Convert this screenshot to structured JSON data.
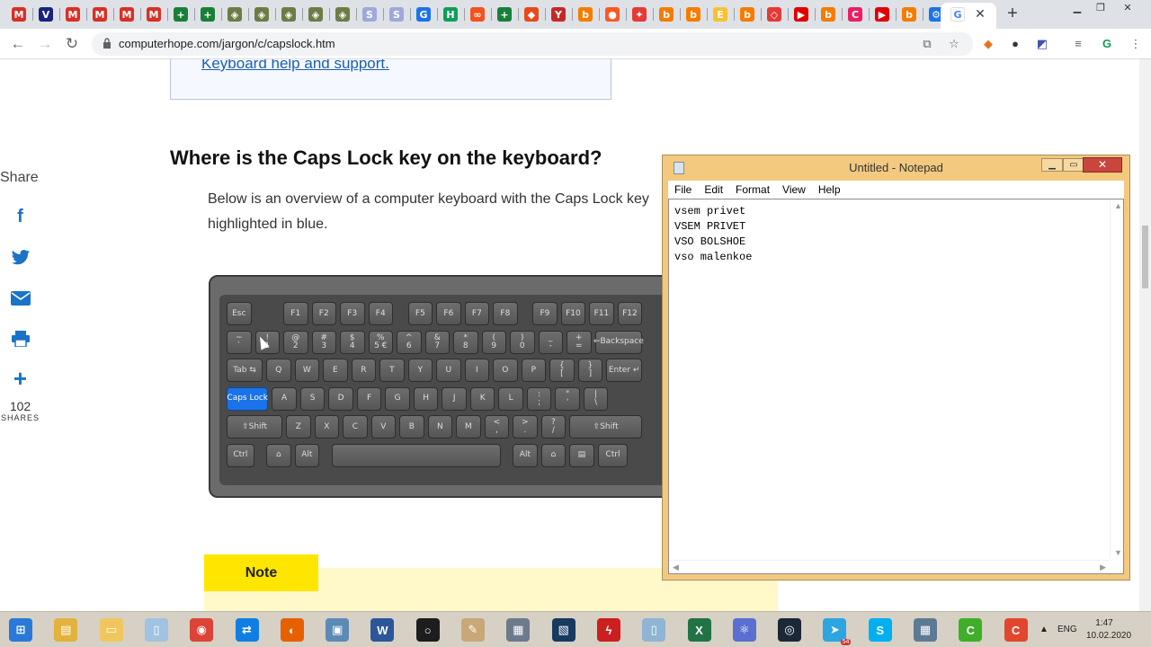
{
  "browser": {
    "url": "computerhope.com/jargon/c/capslock.htm",
    "tabs": [
      {
        "letter": "M",
        "color": "#d93025",
        "icon": "gmail-icon"
      },
      {
        "letter": "V",
        "color": "#1a237e",
        "icon": "v-icon"
      },
      {
        "letter": "M",
        "color": "#d93025",
        "icon": "gmail-icon"
      },
      {
        "letter": "M",
        "color": "#d93025",
        "icon": "gmail-icon"
      },
      {
        "letter": "M",
        "color": "#d93025",
        "icon": "gmail-icon"
      },
      {
        "letter": "M",
        "color": "#d93025",
        "icon": "gmail-icon"
      },
      {
        "letter": "+",
        "color": "#188038",
        "icon": "sheets-icon"
      },
      {
        "letter": "+",
        "color": "#188038",
        "icon": "sheets-icon"
      },
      {
        "letter": "◈",
        "color": "#6b7d44",
        "icon": "site-icon"
      },
      {
        "letter": "◈",
        "color": "#6b7d44",
        "icon": "site-icon"
      },
      {
        "letter": "◈",
        "color": "#6b7d44",
        "icon": "site-icon"
      },
      {
        "letter": "◈",
        "color": "#6b7d44",
        "icon": "site-icon"
      },
      {
        "letter": "◈",
        "color": "#6b7d44",
        "icon": "site-icon"
      },
      {
        "letter": "S",
        "color": "#9fa8da",
        "icon": "sp-icon"
      },
      {
        "letter": "S",
        "color": "#9fa8da",
        "icon": "sp-icon"
      },
      {
        "letter": "G",
        "color": "#1a73e8",
        "icon": "google-icon"
      },
      {
        "letter": "H",
        "color": "#0f9d58",
        "icon": "h-icon"
      },
      {
        "letter": "∞",
        "color": "#f4511e",
        "icon": "link-icon"
      },
      {
        "letter": "+",
        "color": "#188038",
        "icon": "sheets-icon"
      },
      {
        "letter": "◆",
        "color": "#e64a19",
        "icon": "brave-icon"
      },
      {
        "letter": "Y",
        "color": "#c62828",
        "icon": "y-icon"
      },
      {
        "letter": "b",
        "color": "#f57c00",
        "icon": "blogger-icon"
      },
      {
        "letter": "●",
        "color": "#ff5722",
        "icon": "reddit-icon"
      },
      {
        "letter": "✦",
        "color": "#e53935",
        "icon": "star-site-icon"
      },
      {
        "letter": "b",
        "color": "#f57c00",
        "icon": "blogger-icon"
      },
      {
        "letter": "b",
        "color": "#f57c00",
        "icon": "blogger-icon"
      },
      {
        "letter": "E",
        "color": "#fbc02d",
        "icon": "e-icon"
      },
      {
        "letter": "b",
        "color": "#f57c00",
        "icon": "blogger-icon"
      },
      {
        "letter": "◇",
        "color": "#e53935",
        "icon": "diamond-icon"
      },
      {
        "letter": "▶",
        "color": "#e00000",
        "icon": "youtube-icon"
      },
      {
        "letter": "b",
        "color": "#f57c00",
        "icon": "blogger-icon"
      },
      {
        "letter": "C",
        "color": "#e91e63",
        "icon": "c-icon"
      },
      {
        "letter": "▶",
        "color": "#e00000",
        "icon": "youtube-icon"
      },
      {
        "letter": "b",
        "color": "#f57c00",
        "icon": "blogger-icon"
      },
      {
        "letter": "⚙",
        "color": "#1a73e8",
        "icon": "settings-icon"
      },
      {
        "letter": "G",
        "color": "#4285f4",
        "icon": "google-icon"
      }
    ]
  },
  "page": {
    "help_link": "Keyboard help and support.",
    "heading": "Where is the Caps Lock key on the keyboard?",
    "body": "Below is an overview of a computer keyboard with the Caps Lock key highlighted in blue.",
    "share_title": "Share",
    "share_count": "102",
    "share_label": "SHARES",
    "note_label": "Note"
  },
  "keyboard": {
    "rows": [
      [
        [
          "Esc",
          0,
          1.0
        ],
        [
          "F1",
          2,
          1.0
        ],
        [
          "F2",
          3,
          1.0
        ],
        [
          "F3",
          4,
          1.0
        ],
        [
          "F4",
          5,
          1.0
        ],
        [
          "F5",
          6.4,
          1.0
        ],
        [
          "F6",
          7.4,
          1.0
        ],
        [
          "F7",
          8.4,
          1.0
        ],
        [
          "F8",
          9.4,
          1.0
        ],
        [
          "F9",
          10.8,
          1.0
        ],
        [
          "F10",
          11.8,
          1.0
        ],
        [
          "F11",
          12.8,
          1.0
        ],
        [
          "F12",
          13.8,
          1.0
        ]
      ],
      [
        [
          "~\n`",
          0,
          1.0
        ],
        [
          "!\n1",
          1,
          1.0
        ],
        [
          "@\n2",
          2,
          1.0
        ],
        [
          "#\n3",
          3,
          1.0
        ],
        [
          "$\n4",
          4,
          1.0
        ],
        [
          "%\n5 €",
          5,
          1.0
        ],
        [
          "^\n6",
          6,
          1.0
        ],
        [
          "&\n7",
          7,
          1.0
        ],
        [
          "*\n8",
          8,
          1.0
        ],
        [
          "(\n9",
          9,
          1.0
        ],
        [
          ")\n0",
          10,
          1.0
        ],
        [
          "_\n-",
          11,
          1.0
        ],
        [
          "+\n=",
          12,
          1.0
        ],
        [
          "←Backspace",
          13,
          1.8
        ]
      ],
      [
        [
          "Tab ⇆",
          0,
          1.4
        ],
        [
          "Q",
          1.4,
          1.0
        ],
        [
          "W",
          2.4,
          1.0
        ],
        [
          "E",
          3.4,
          1.0
        ],
        [
          "R",
          4.4,
          1.0
        ],
        [
          "T",
          5.4,
          1.0
        ],
        [
          "Y",
          6.4,
          1.0
        ],
        [
          "U",
          7.4,
          1.0
        ],
        [
          "I",
          8.4,
          1.0
        ],
        [
          "O",
          9.4,
          1.0
        ],
        [
          "P",
          10.4,
          1.0
        ],
        [
          "{\n[",
          11.4,
          1.0
        ],
        [
          "}\n]",
          12.4,
          1.0
        ],
        [
          "Enter ↵",
          13.4,
          1.4
        ]
      ],
      [
        [
          "Caps Lock",
          0,
          1.6,
          "caps"
        ],
        [
          "A",
          1.6,
          1.0
        ],
        [
          "S",
          2.6,
          1.0
        ],
        [
          "D",
          3.6,
          1.0
        ],
        [
          "F",
          4.6,
          1.0
        ],
        [
          "G",
          5.6,
          1.0
        ],
        [
          "H",
          6.6,
          1.0
        ],
        [
          "J",
          7.6,
          1.0
        ],
        [
          "K",
          8.6,
          1.0
        ],
        [
          "L",
          9.6,
          1.0
        ],
        [
          ":\n;",
          10.6,
          1.0
        ],
        [
          "\"\n'",
          11.6,
          1.0
        ],
        [
          "|\n\\",
          12.6,
          1.0
        ]
      ],
      [
        [
          "⇧Shift",
          0,
          2.1
        ],
        [
          "Z",
          2.1,
          1.0
        ],
        [
          "X",
          3.1,
          1.0
        ],
        [
          "C",
          4.1,
          1.0
        ],
        [
          "V",
          5.1,
          1.0
        ],
        [
          "B",
          6.1,
          1.0
        ],
        [
          "N",
          7.1,
          1.0
        ],
        [
          "M",
          8.1,
          1.0
        ],
        [
          "<\n,",
          9.1,
          1.0
        ],
        [
          ">\n.",
          10.1,
          1.0
        ],
        [
          "?\n/",
          11.1,
          1.0
        ],
        [
          "⇧Shift",
          12.1,
          2.7
        ]
      ],
      [
        [
          "Ctrl",
          0,
          1.1
        ],
        [
          "⌂",
          1.4,
          1.0
        ],
        [
          "Alt",
          2.4,
          1.0
        ],
        [
          "",
          3.7,
          6.1
        ],
        [
          "Alt",
          10.1,
          1.0
        ],
        [
          "⌂",
          11.1,
          1.0
        ],
        [
          "▤",
          12.1,
          1.0
        ],
        [
          "Ctrl",
          13.1,
          1.2
        ]
      ]
    ]
  },
  "notepad": {
    "title": "Untitled - Notepad",
    "menu": [
      "File",
      "Edit",
      "Format",
      "View",
      "Help"
    ],
    "lines": [
      "vsem privet",
      "VSEM PRIVET",
      "VSO BOLSHOE",
      "vso malenkoe"
    ]
  },
  "taskbar": {
    "apps": [
      {
        "icon": "start-icon",
        "color": "#2a79d8",
        "glyph": "⊞"
      },
      {
        "icon": "file-explorer-icon",
        "color": "#e3b23c",
        "glyph": "▤"
      },
      {
        "icon": "folder-icon",
        "color": "#f0c75e",
        "glyph": "▭"
      },
      {
        "icon": "notepad-icon",
        "color": "#9fc3e0",
        "glyph": "▯"
      },
      {
        "icon": "chrome-icon",
        "color": "#db4437",
        "glyph": "◉"
      },
      {
        "icon": "teamviewer-icon",
        "color": "#0e7ee5",
        "glyph": "⇄"
      },
      {
        "icon": "firefox-icon",
        "color": "#e66000",
        "glyph": "◐"
      },
      {
        "icon": "screenshot-icon",
        "color": "#5b8ab5",
        "glyph": "▣"
      },
      {
        "icon": "word-icon",
        "color": "#2b579a",
        "glyph": "W"
      },
      {
        "icon": "obs-icon",
        "color": "#1d1d1d",
        "glyph": "○"
      },
      {
        "icon": "paint-icon",
        "color": "#c8a878",
        "glyph": "✎"
      },
      {
        "icon": "network-icon",
        "color": "#6b7b8c",
        "glyph": "▦"
      },
      {
        "icon": "virtualbox-icon",
        "color": "#183a61",
        "glyph": "▧"
      },
      {
        "icon": "flash-icon",
        "color": "#cc1f1f",
        "glyph": "ϟ"
      },
      {
        "icon": "notepad2-icon",
        "color": "#8fb4d4",
        "glyph": "▯"
      },
      {
        "icon": "excel-icon",
        "color": "#217346",
        "glyph": "X"
      },
      {
        "icon": "atom-icon",
        "color": "#5a6fd0",
        "glyph": "⚛"
      },
      {
        "icon": "steam-icon",
        "color": "#1b2838",
        "glyph": "◎"
      },
      {
        "icon": "telegram-icon",
        "color": "#2ca5e0",
        "glyph": "➤"
      },
      {
        "icon": "skype-icon",
        "color": "#00aff0",
        "glyph": "S"
      },
      {
        "icon": "calculator-icon",
        "color": "#5d7a95",
        "glyph": "▦"
      },
      {
        "icon": "camtasia-icon",
        "color": "#3fae2a",
        "glyph": "C"
      },
      {
        "icon": "camtasia-recorder-icon",
        "color": "#e2462f",
        "glyph": "C"
      }
    ],
    "telegram_badge": "54",
    "language": "ENG",
    "time": "1:47",
    "date": "10.02.2020"
  }
}
